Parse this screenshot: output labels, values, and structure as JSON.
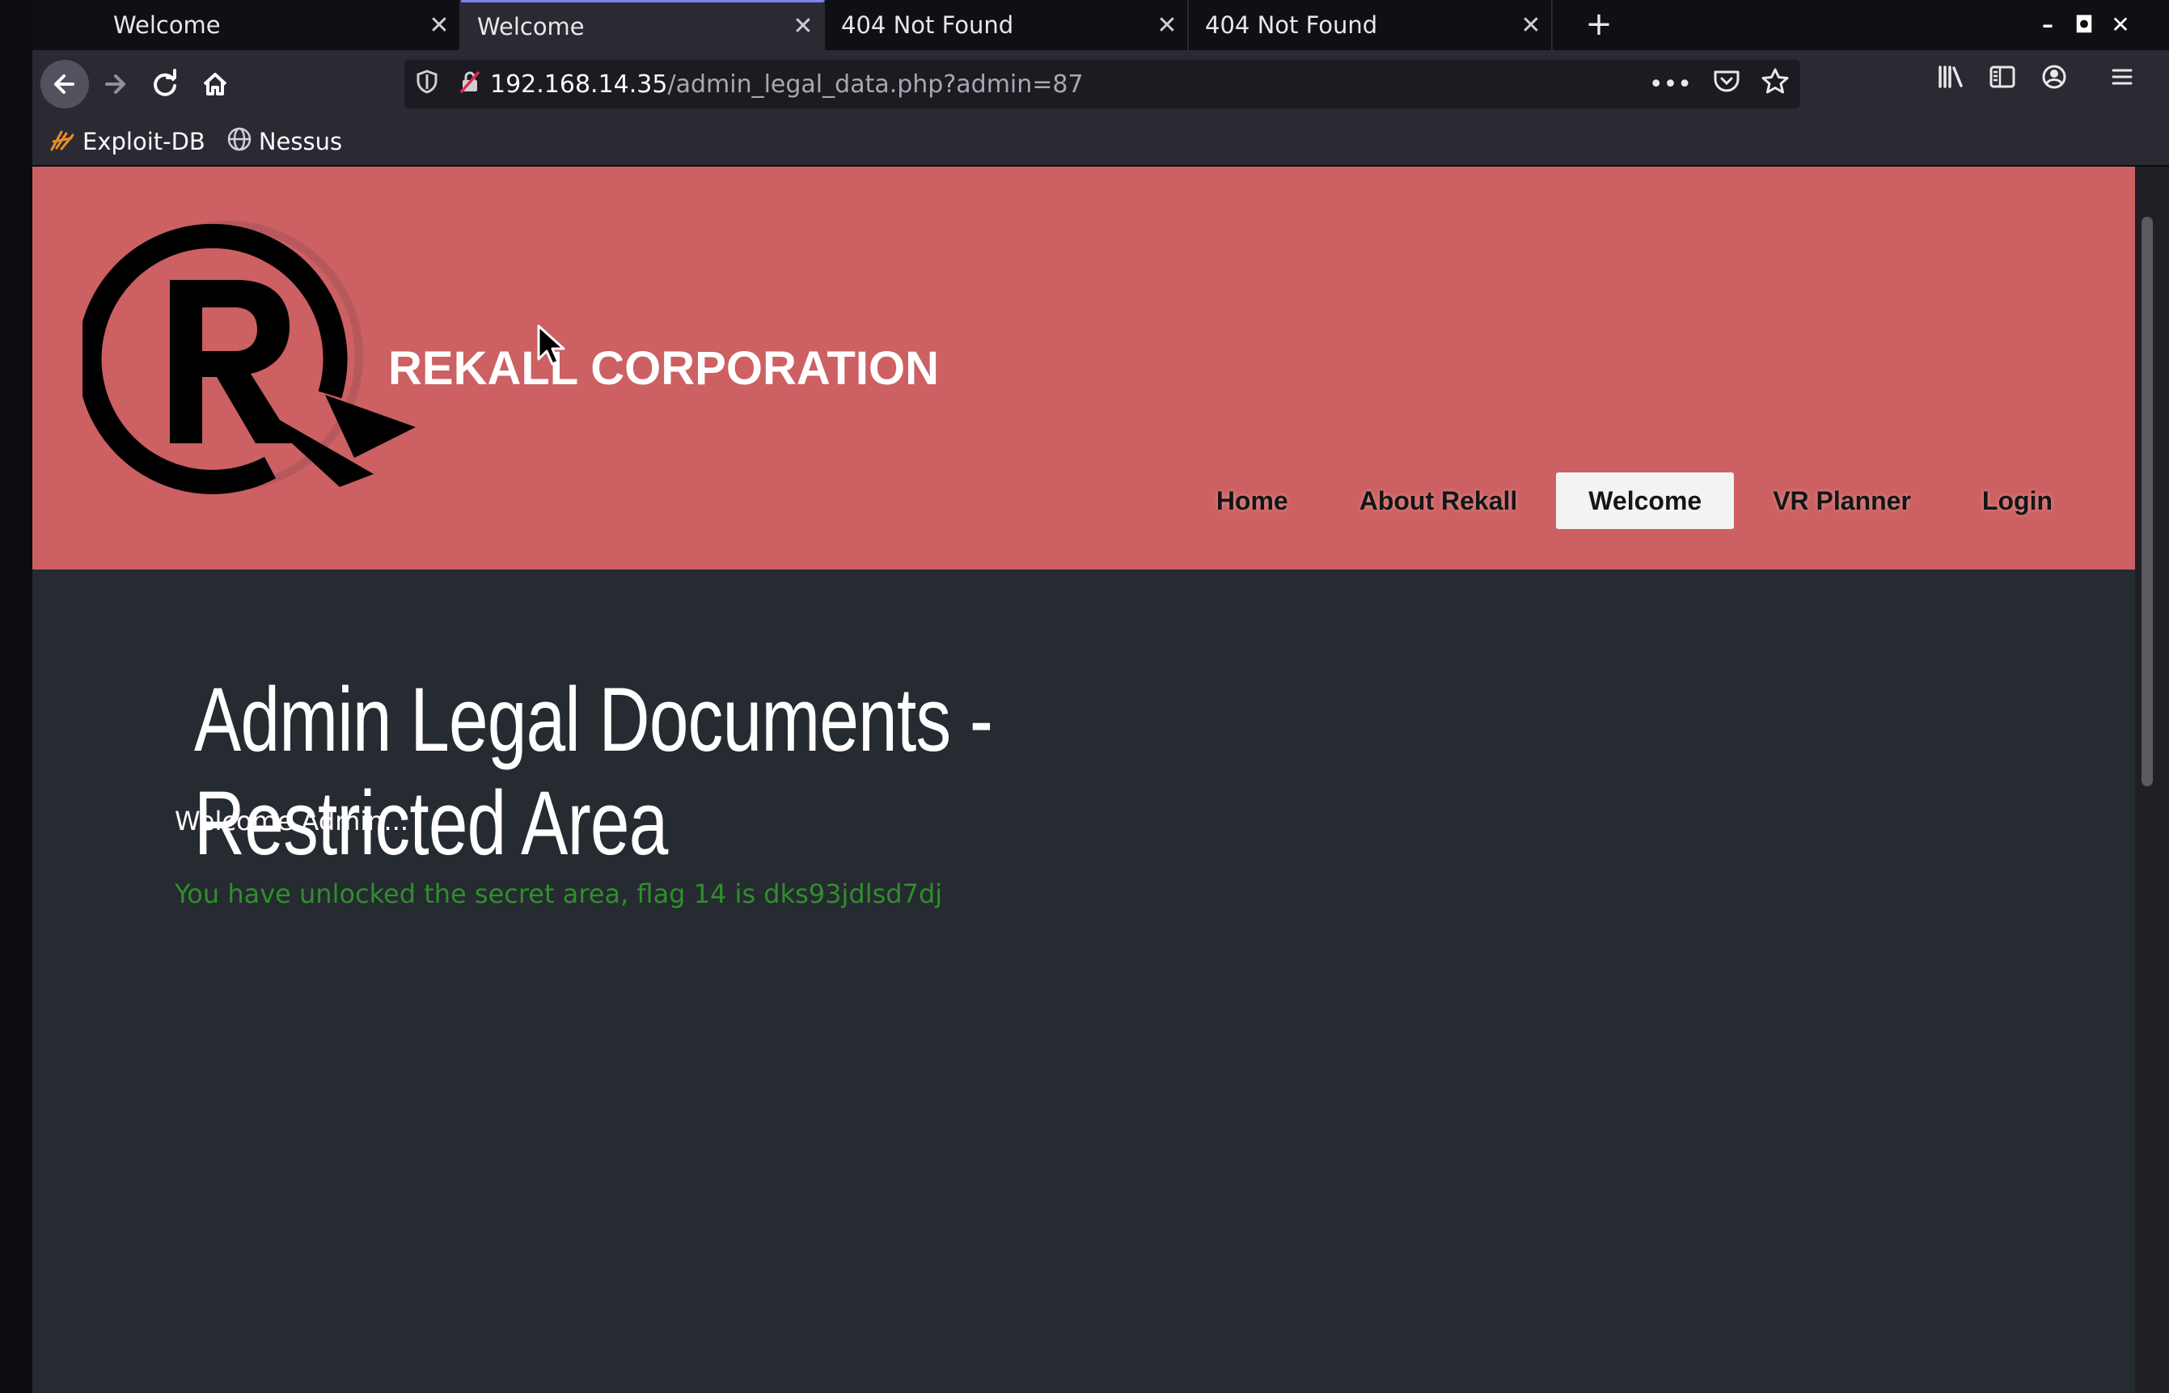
{
  "tabs": [
    {
      "title": "Welcome",
      "active": false
    },
    {
      "title": "Welcome",
      "active": true
    },
    {
      "title": "404 Not Found",
      "active": false
    },
    {
      "title": "404 Not Found",
      "active": false
    }
  ],
  "tab_close_symbol": "✕",
  "new_tab_symbol": "+",
  "window_controls": {
    "minimize": "–",
    "maximize": "◘",
    "close": "✕"
  },
  "navbar": {
    "url_host": "192.168.14.35",
    "url_path": "/admin_legal_data.php?admin=87",
    "icons": [
      "back-arrow-icon",
      "forward-arrow-icon",
      "reload-icon",
      "home-icon",
      "shield-icon",
      "insecure-lock-icon",
      "more-dots-icon",
      "pocket-icon",
      "bookmark-star-icon",
      "library-icon",
      "sidebar-icon",
      "account-icon",
      "hamburger-menu-icon"
    ]
  },
  "bookmarks": [
    {
      "label": "Exploit-DB",
      "icon": "exploitdb-icon"
    },
    {
      "label": "Nessus",
      "icon": "globe-icon"
    }
  ],
  "site": {
    "company_name": "REKALL CORPORATION",
    "header_color": "#cc6062",
    "nav": [
      {
        "label": "Home",
        "active": false
      },
      {
        "label": "About Rekall",
        "active": false
      },
      {
        "label": "Welcome",
        "active": true
      },
      {
        "label": "VR Planner",
        "active": false
      },
      {
        "label": "Login",
        "active": false
      }
    ],
    "page_title_line1": "Admin Legal Documents -",
    "page_title_line2": "Restricted Area",
    "welcome_text": "Welcome Admin...",
    "flag_text": "You have unlocked the secret area, flag 14 is dks93jdlsd7dj",
    "flag_color": "#2f8f2b",
    "body_bg": "#262a31"
  }
}
